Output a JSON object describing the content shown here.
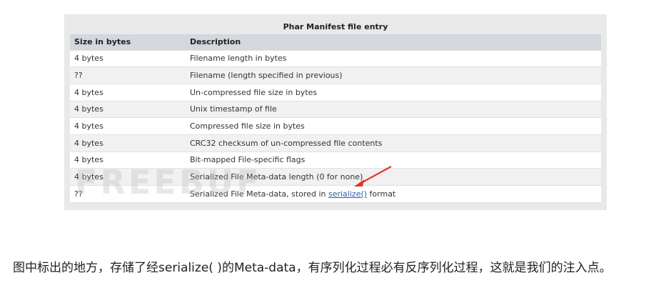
{
  "table": {
    "caption": "Phar Manifest file entry",
    "headers": [
      "Size in bytes",
      "Description"
    ],
    "rows": [
      {
        "size": "4 bytes",
        "desc": "Filename length in bytes"
      },
      {
        "size": "??",
        "desc": "Filename (length specified in previous)"
      },
      {
        "size": "4 bytes",
        "desc": "Un-compressed file size in bytes"
      },
      {
        "size": "4 bytes",
        "desc": "Unix timestamp of file"
      },
      {
        "size": "4 bytes",
        "desc": "Compressed file size in bytes"
      },
      {
        "size": "4 bytes",
        "desc": "CRC32 checksum of un-compressed file contents"
      },
      {
        "size": "4 bytes",
        "desc": "Bit-mapped File-specific flags"
      },
      {
        "size": "4 bytes",
        "desc": "Serialized File Meta-data length (0 for none)"
      },
      {
        "size": "??",
        "desc_prefix": "Serialized File Meta-data, stored in ",
        "desc_link": "serialize()",
        "desc_suffix": " format"
      }
    ]
  },
  "watermark": "FREEBUF",
  "arrow_color": "#e53333",
  "paragraph": "图中标出的地方，存储了经serialize( )的Meta-data，有序列化过程必有反序列化过程，这就是我们的注入点。"
}
